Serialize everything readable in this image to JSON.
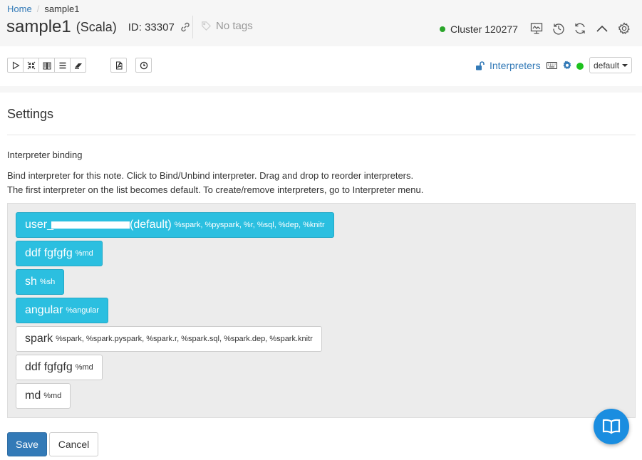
{
  "breadcrumb": {
    "home": "Home",
    "separator": "/",
    "current": "sample1"
  },
  "note": {
    "name": "sample1",
    "language": "(Scala)",
    "id_text": "ID: 33307"
  },
  "tags": {
    "placeholder": "No tags"
  },
  "cluster": {
    "label": "Cluster 120277",
    "status_color": "#2aa52a"
  },
  "header_icons": [
    "monitor-icon",
    "history-icon",
    "refresh-icon",
    "chevron-up-icon",
    "settings-icon"
  ],
  "toolbar": {
    "run_buttons": [
      "run-all-icon",
      "collapse-all-icon",
      "toggle-output-icon",
      "list-icon",
      "clear-output-icon"
    ],
    "export_icon": "pdf-icon",
    "scheduler_icon": "clock-icon",
    "interpreters_label": "Interpreters",
    "default_select": "default"
  },
  "settings": {
    "title": "Settings",
    "binding_label": "Interpreter binding",
    "desc_line1": "Bind interpreter for this note. Click to Bind/Unbind interpreter. Drag and drop to reorder interpreters.",
    "desc_line2": "The first interpreter on the list becomes default. To create/remove interpreters, go to Interpreter menu."
  },
  "interpreters": [
    {
      "name_prefix": "user_",
      "name_suffix": "(default)",
      "aliases": "%spark, %pyspark, %r, %sql, %dep, %knitr",
      "bound": true
    },
    {
      "name": "ddf fgfgfg",
      "aliases": "%md",
      "bound": true
    },
    {
      "name": "sh",
      "aliases": "%sh",
      "bound": true
    },
    {
      "name": "angular",
      "aliases": "%angular",
      "bound": true
    },
    {
      "name": "spark",
      "aliases": "%spark, %spark.pyspark, %spark.r, %spark.sql, %spark.dep, %spark.knitr",
      "bound": false
    },
    {
      "name": "ddf fgfgfg",
      "aliases": "%md",
      "bound": false
    },
    {
      "name": "md",
      "aliases": "%md",
      "bound": false
    }
  ],
  "actions": {
    "save": "Save",
    "cancel": "Cancel"
  },
  "colors": {
    "accent": "#337ab7",
    "bound": "#2bbfe0",
    "fab": "#1a8de0"
  }
}
